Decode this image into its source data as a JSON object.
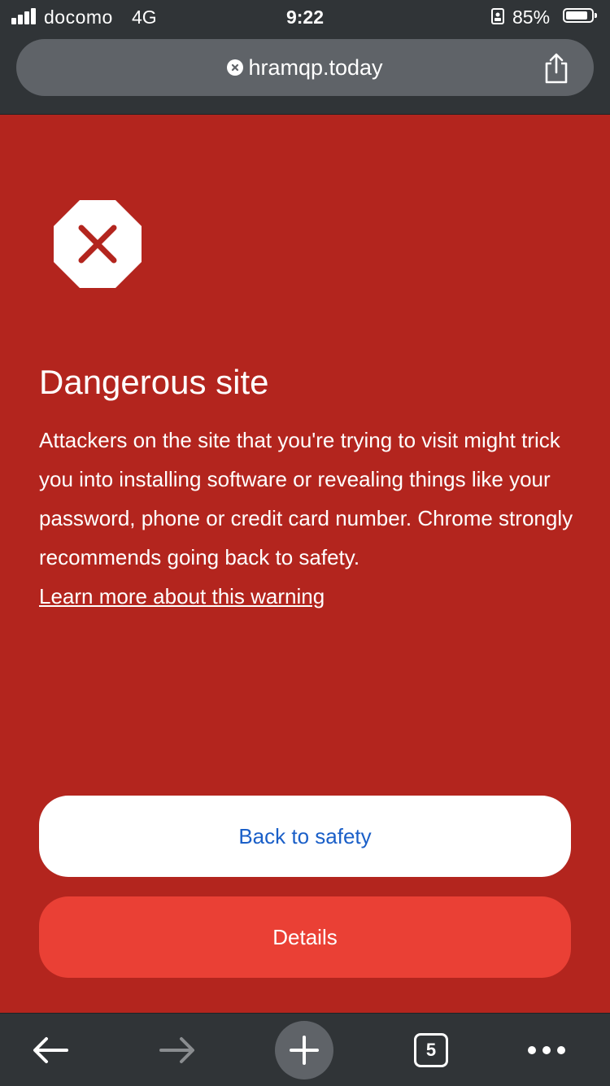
{
  "status_bar": {
    "carrier": "docomo",
    "network": "4G",
    "time": "9:22",
    "battery_percent": "85%",
    "battery_level": 0.85
  },
  "url_bar": {
    "domain": "hramqp.today",
    "security_icon": "not-secure-x-icon",
    "share_icon": "share-icon"
  },
  "interstitial": {
    "icon": "stop-octagon-x-icon",
    "title": "Dangerous site",
    "body": "Attackers on the site that you're trying to visit might trick you into installing software or revealing things like your password, phone or credit card number. Chrome strongly recommends going back to safety.",
    "learn_more": "Learn more about this warning",
    "back_button": "Back to safety",
    "details_button": "Details"
  },
  "toolbar": {
    "tab_count": "5",
    "icons": [
      "back-arrow-icon",
      "forward-arrow-icon",
      "new-tab-plus-icon",
      "tab-switcher-icon",
      "more-dots-icon"
    ]
  },
  "colors": {
    "background_red": "#b3251e",
    "details_red": "#ea4035",
    "link_blue": "#1a5fc8",
    "chrome_dark": "#303437",
    "url_bar_gray": "#5f6368"
  }
}
